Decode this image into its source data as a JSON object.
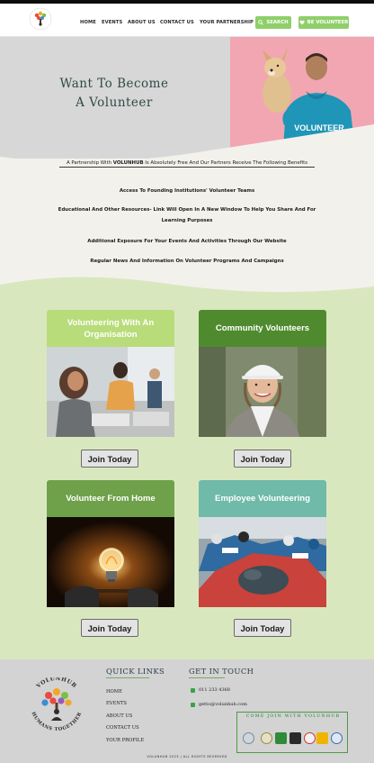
{
  "nav": {
    "brand": "VOLUNHUB",
    "links": [
      "HOME",
      "EVENTS",
      "ABOUT US",
      "CONTACT US",
      "YOUR PARTNERSHIP"
    ],
    "search_label": "SEARCH",
    "volunteer_label": "BE VOLUNTEER"
  },
  "hero": {
    "title_line1": "Want To Become",
    "title_line2": "A Volunteer",
    "shirt_text": "VOLUNTEER"
  },
  "benefits": {
    "intro_before": "A Partnership With ",
    "intro_brand": "VOLUNHUB",
    "intro_after": " Is Absolutely Free And Our Partners Receive The Following Benefits",
    "items": [
      "Access To Founding Institutions' Volunteer Teams",
      "Educational And Other Resources- Link Will Open In A New Window To Help You Share And For Learning Purposes",
      "Additional Exposure For Your Events And Activities Through Our Website",
      "Regular News And Information On Volunteer Programs And Campaigns"
    ]
  },
  "cards": [
    {
      "title": "Volunteering With An Organisation",
      "button": "Join Today"
    },
    {
      "title": "Community Volunteers",
      "button": "Join Today"
    },
    {
      "title": "Volunteer From Home",
      "button": "Join Today"
    },
    {
      "title": "Employee Volunteering",
      "button": "Join Today"
    }
  ],
  "footer": {
    "logo_text_top": "VOLUNHUB",
    "logo_text_bottom": "HUMANS TOGETHER",
    "quick_links_title": "QUICK LINKS",
    "quick_links": [
      "HOME",
      "EVENTS",
      "ABOUT US",
      "CONTACT US",
      "YOUR PROFILE"
    ],
    "contact_title": "GET IN TOUCH",
    "phone": "011 233 4368",
    "email": "getto@volunhub.com",
    "partners_title": "COME JOIN WITH VOLUNHUB",
    "copyright": "VOLUNHUB 2023 | ALL RIGHTS RESERVED"
  },
  "colors": {
    "accent_green": "#8fcf6a",
    "hero_pink": "#f3a9b4",
    "section_green": "#d9e7bf"
  }
}
